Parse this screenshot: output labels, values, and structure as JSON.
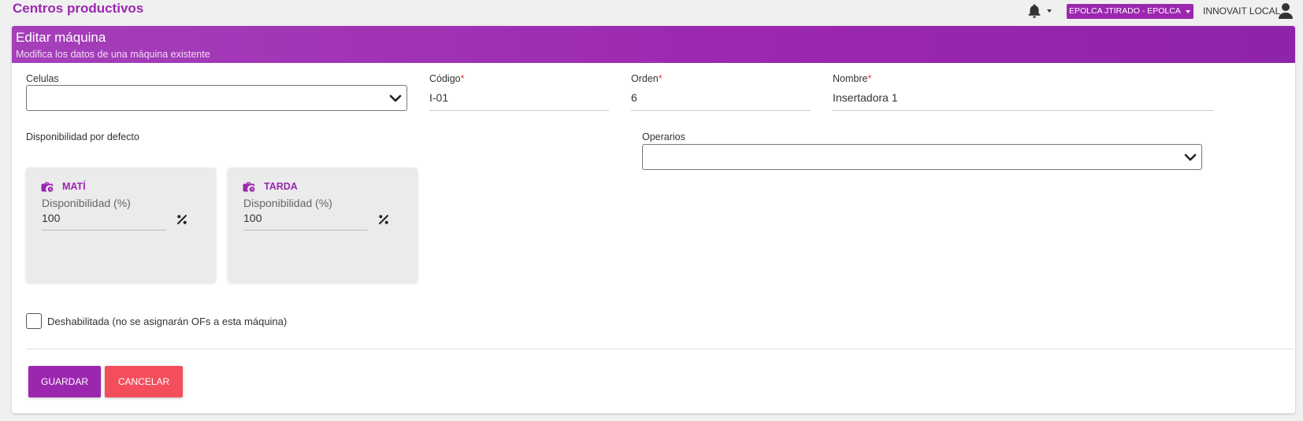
{
  "app": {
    "title": "Centros productivos"
  },
  "header": {
    "company_label": "EPOLCA JTIRADO - EPOLCA",
    "user_label": "INNOVAIT LOCAL"
  },
  "card": {
    "title": "Editar máquina",
    "subtitle": "Modifica los datos de una máquina existente"
  },
  "form": {
    "celulas": {
      "label": "Celulas",
      "value": ""
    },
    "codigo": {
      "label": "Código",
      "required_mark": "*",
      "value": "I-01"
    },
    "orden": {
      "label": "Orden",
      "required_mark": "*",
      "value": "6"
    },
    "nombre": {
      "label": "Nombre",
      "required_mark": "*",
      "value": "Insertadora 1"
    },
    "disponibilidad_label": "Disponibilidad por defecto",
    "operarios": {
      "label": "Operarios",
      "value": ""
    },
    "shifts": [
      {
        "name": "MATÍ",
        "field_label": "Disponibilidad (%)",
        "value": "100",
        "icon": "shift-clock-icon",
        "suffix_icon": "percent-icon"
      },
      {
        "name": "TARDA",
        "field_label": "Disponibilidad (%)",
        "value": "100",
        "icon": "shift-clock-icon",
        "suffix_icon": "percent-icon"
      }
    ],
    "disabled": {
      "label": "Deshabilitada (no se asignarán OFs a esta máquina)",
      "checked": false
    }
  },
  "buttons": {
    "save": "GUARDAR",
    "cancel": "CANCELAR"
  },
  "colors": {
    "accent": "#9b27af",
    "danger": "#f44e5c",
    "required": "#e53935"
  },
  "icons": {
    "notifications": "bell-icon",
    "user": "user-icon",
    "select": "chevron-down-icon"
  }
}
